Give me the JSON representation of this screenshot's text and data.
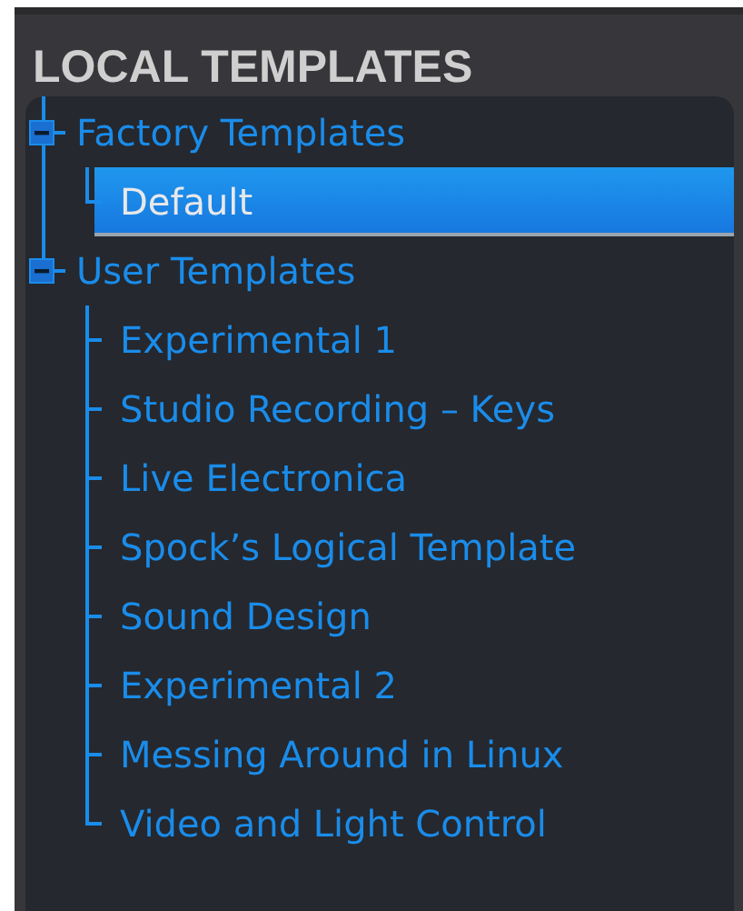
{
  "title": "LOCAL TEMPLATES",
  "groups": [
    {
      "label": "Factory Templates",
      "expanded": true,
      "children": [
        {
          "label": "Default",
          "selected": true
        }
      ]
    },
    {
      "label": "User Templates",
      "expanded": true,
      "children": [
        {
          "label": "Experimental 1",
          "selected": false
        },
        {
          "label": "Studio Recording – Keys",
          "selected": false
        },
        {
          "label": "Live Electronica",
          "selected": false
        },
        {
          "label": "Spock’s Logical Template",
          "selected": false
        },
        {
          "label": "Sound Design",
          "selected": false
        },
        {
          "label": "Experimental 2",
          "selected": false
        },
        {
          "label": "Messing Around in Linux",
          "selected": false
        },
        {
          "label": "Video and Light Control",
          "selected": false
        }
      ]
    }
  ]
}
